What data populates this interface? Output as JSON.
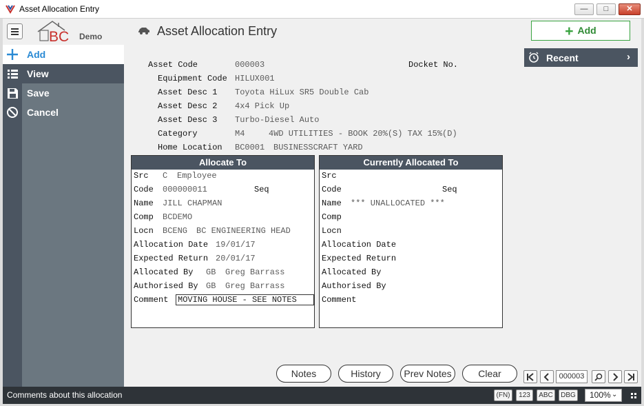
{
  "window": {
    "title": "Asset Allocation Entry"
  },
  "header": {
    "logo_text": "BC",
    "logo_sub": "Demo",
    "page_title": "Asset Allocation Entry",
    "add_label": "Add"
  },
  "sidebar": {
    "items": [
      {
        "label": "Add",
        "icon": "plus-icon"
      },
      {
        "label": "View",
        "icon": "list-icon"
      },
      {
        "label": "Save",
        "icon": "save-icon"
      },
      {
        "label": "Cancel",
        "icon": "cancel-icon"
      }
    ]
  },
  "recent": {
    "label": "Recent"
  },
  "asset": {
    "asset_code_label": "Asset Code",
    "asset_code": "000003",
    "docket_label": "Docket No.",
    "equipment_code_label": "Equipment Code",
    "equipment_code": "HILUX001",
    "desc1_label": "Asset Desc 1",
    "desc1": "Toyota HiLux SR5 Double Cab",
    "desc2_label": "Asset Desc 2",
    "desc2": "4x4 Pick Up",
    "desc3_label": "Asset Desc 3",
    "desc3": "Turbo-Diesel Auto",
    "category_label": "Category",
    "category_code": "M4",
    "category_desc": "4WD UTILITIES - BOOK 20%(S) TAX 15%(D)",
    "home_location_label": "Home Location",
    "home_location_code": "BC0001",
    "home_location_desc": "BUSINESSCRAFT YARD"
  },
  "allocate_to": {
    "heading": "Allocate To",
    "src_label": "Src",
    "src_code": "C",
    "src_desc": "Employee",
    "code_label": "Code",
    "code": "000000011",
    "seq_label": "Seq",
    "name_label": "Name",
    "name": "JILL CHAPMAN",
    "comp_label": "Comp",
    "comp": "BCDEMO",
    "locn_label": "Locn",
    "locn_code": "BCENG",
    "locn_desc": "BC ENGINEERING HEAD",
    "alloc_date_label": "Allocation Date",
    "alloc_date": "19/01/17",
    "expected_return_label": "Expected Return",
    "expected_return": "20/01/17",
    "allocated_by_label": "Allocated By",
    "allocated_by_code": "GB",
    "allocated_by_name": "Greg Barrass",
    "authorised_by_label": "Authorised By",
    "authorised_by_code": "GB",
    "authorised_by_name": "Greg Barrass",
    "comment_label": "Comment",
    "comment": "MOVING HOUSE - SEE NOTES"
  },
  "currently_allocated": {
    "heading": "Currently Allocated To",
    "src_label": "Src",
    "code_label": "Code",
    "seq_label": "Seq",
    "name_label": "Name",
    "name": "*** UNALLOCATED ***",
    "comp_label": "Comp",
    "locn_label": "Locn",
    "alloc_date_label": "Allocation Date",
    "expected_return_label": "Expected Return",
    "allocated_by_label": "Allocated By",
    "authorised_by_label": "Authorised By",
    "comment_label": "Comment"
  },
  "actions": {
    "notes": "Notes",
    "history": "History",
    "prev_notes": "Prev Notes",
    "clear": "Clear"
  },
  "navigator": {
    "first": "K",
    "prev": "<",
    "record": "000003",
    "next": ">",
    "last": ">|"
  },
  "status": {
    "message": "Comments about this allocation",
    "fn": "(FN)",
    "num": "123",
    "caps": "ABC",
    "dbg": "DBG",
    "zoom": "100%"
  },
  "colors": {
    "sidebar": "#6b7780",
    "sidebar_dark": "#4b5561",
    "accent_green": "#38a33f",
    "accent_blue": "#2a8ad4",
    "statusbar": "#2e3338"
  }
}
